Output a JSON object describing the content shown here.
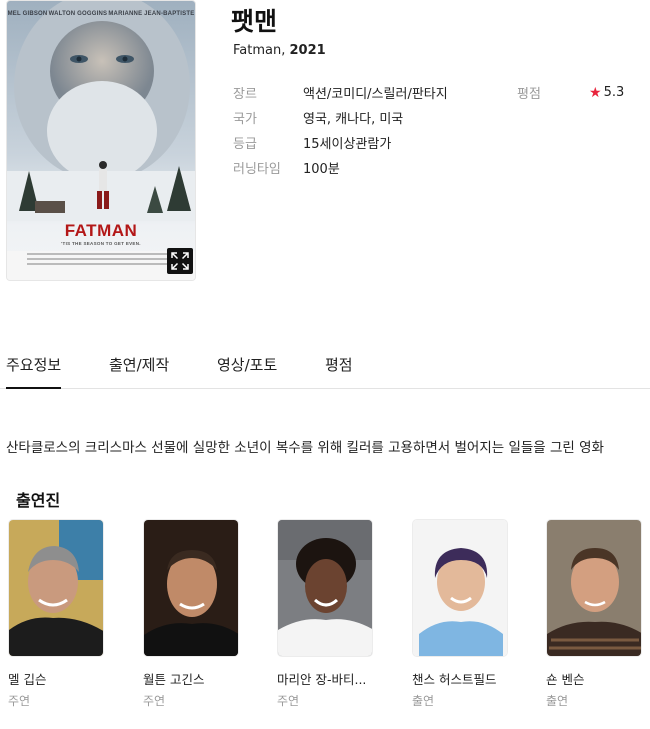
{
  "poster": {
    "cast_line": [
      "MEL GIBSON",
      "WALTON GOGGINS",
      "MARIANNE JEAN-BAPTISTE"
    ],
    "title": "FATMAN",
    "tagline": "'TIS THE SEASON TO GET EVEN.",
    "expand_icon": "expand-icon"
  },
  "movie": {
    "title": "팻맨",
    "original_title": "Fatman",
    "year": "2021"
  },
  "info": [
    {
      "key": "장르",
      "value": "액션/코미디/스릴러/판타지"
    },
    {
      "key": "국가",
      "value": "영국, 캐나다, 미국"
    },
    {
      "key": "등급",
      "value": "15세이상관람가"
    },
    {
      "key": "러닝타임",
      "value": "100분"
    }
  ],
  "rating": {
    "label": "평점",
    "value": "5.3",
    "star_color": "#e8243c"
  },
  "tabs": [
    {
      "label": "주요정보",
      "active": true
    },
    {
      "label": "출연/제작",
      "active": false
    },
    {
      "label": "영상/포토",
      "active": false
    },
    {
      "label": "평점",
      "active": false
    }
  ],
  "synopsis": "산타클로스의 크리스마스 선물에 실망한 소년이 복수를 위해 킬러를 고용하면서 벌어지는 일들을 그린 영화",
  "cast_section": {
    "title": "출연진",
    "members": [
      {
        "name": "멜 깁슨",
        "role": "주연"
      },
      {
        "name": "월튼 고긴스",
        "role": "주연"
      },
      {
        "name": "마리안 장-바티...",
        "role": "주연"
      },
      {
        "name": "챈스 허스트필드",
        "role": "출연"
      },
      {
        "name": "숀 벤슨",
        "role": "출연"
      }
    ]
  }
}
